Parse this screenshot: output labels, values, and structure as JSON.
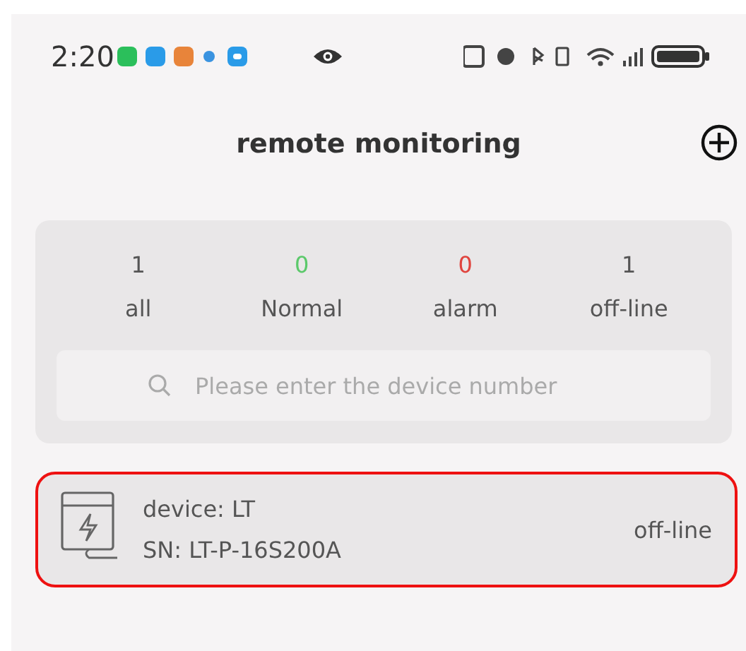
{
  "status_bar": {
    "time": "2:20"
  },
  "header": {
    "title": "remote monitoring"
  },
  "stats": [
    {
      "count": "1",
      "label": "all",
      "color": "#555555"
    },
    {
      "count": "0",
      "label": "Normal",
      "color": "#5cc96b"
    },
    {
      "count": "0",
      "label": "alarm",
      "color": "#e0443e"
    },
    {
      "count": "1",
      "label": "off-line",
      "color": "#555555"
    }
  ],
  "search": {
    "placeholder": "Please enter the device number"
  },
  "devices": [
    {
      "name": "device: LT",
      "sn": "SN: LT-P-16S200A",
      "status": "off-line",
      "selected": true
    }
  ]
}
